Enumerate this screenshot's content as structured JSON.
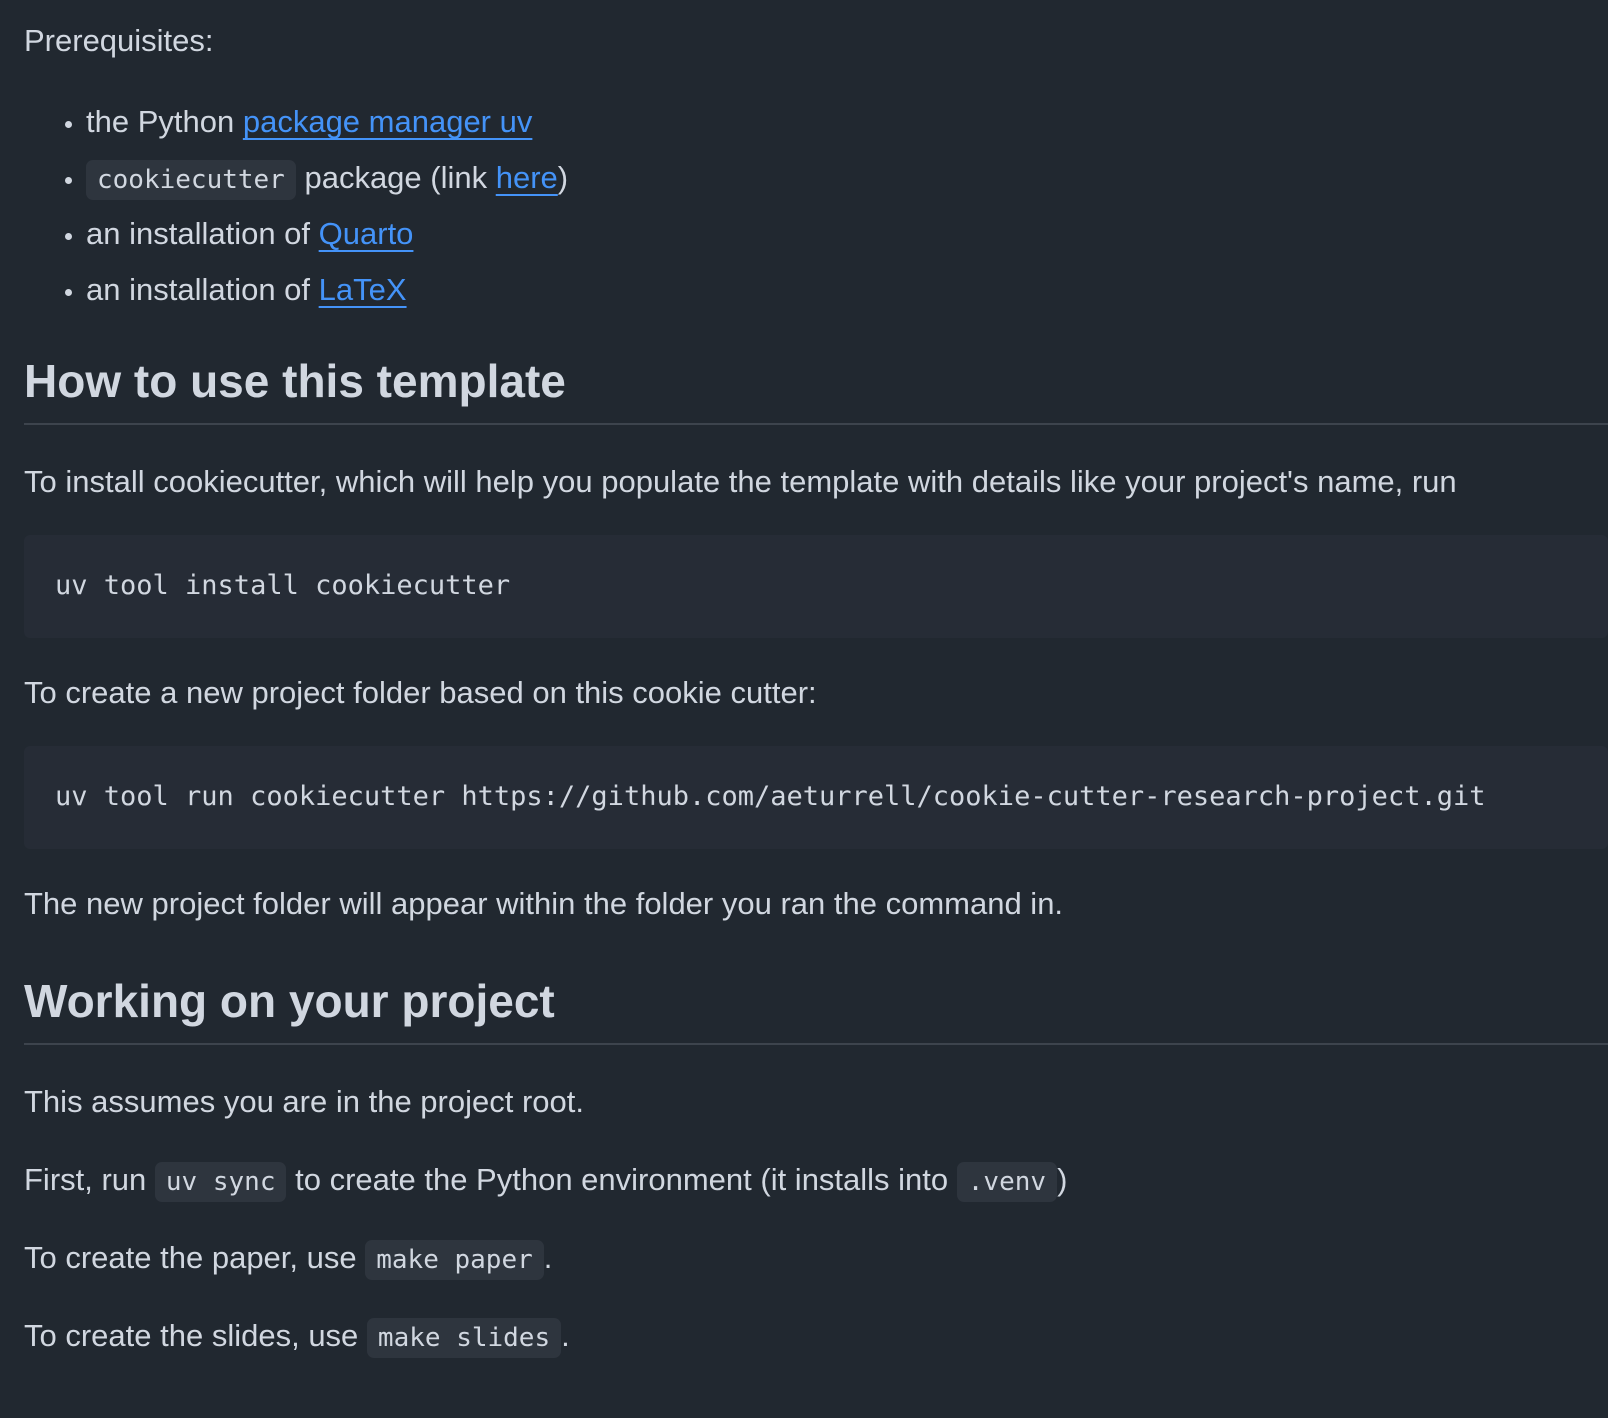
{
  "prerequisites": {
    "label": "Prerequisites:",
    "items": [
      {
        "prefix": "the Python ",
        "link": "package manager uv"
      },
      {
        "code": "cookiecutter",
        "middle": " package (link ",
        "link": "here",
        "suffix": ")"
      },
      {
        "prefix": "an installation of ",
        "link": "Quarto"
      },
      {
        "prefix": "an installation of ",
        "link": "LaTeX"
      }
    ]
  },
  "section_use": {
    "heading": "How to use this template",
    "install_text": "To install cookiecutter, which will help you populate the template with details like your project's name, run",
    "install_command": "uv tool install cookiecutter",
    "create_text": "To create a new project folder based on this cookie cutter:",
    "create_command": "uv tool run cookiecutter https://github.com/aeturrell/cookie-cutter-research-project.git",
    "appear_text": "The new project folder will appear within the folder you ran the command in."
  },
  "section_work": {
    "heading": "Working on your project",
    "assume_text": "This assumes you are in the project root.",
    "first_prefix": "First, run ",
    "first_code": "uv sync",
    "first_middle": " to create the Python environment (it installs into ",
    "first_code2": ".venv",
    "first_suffix": ")",
    "paper_prefix": "To create the paper, use ",
    "paper_code": "make paper",
    "paper_suffix": ".",
    "slides_prefix": "To create the slides, use ",
    "slides_code": "make slides",
    "slides_suffix": "."
  }
}
